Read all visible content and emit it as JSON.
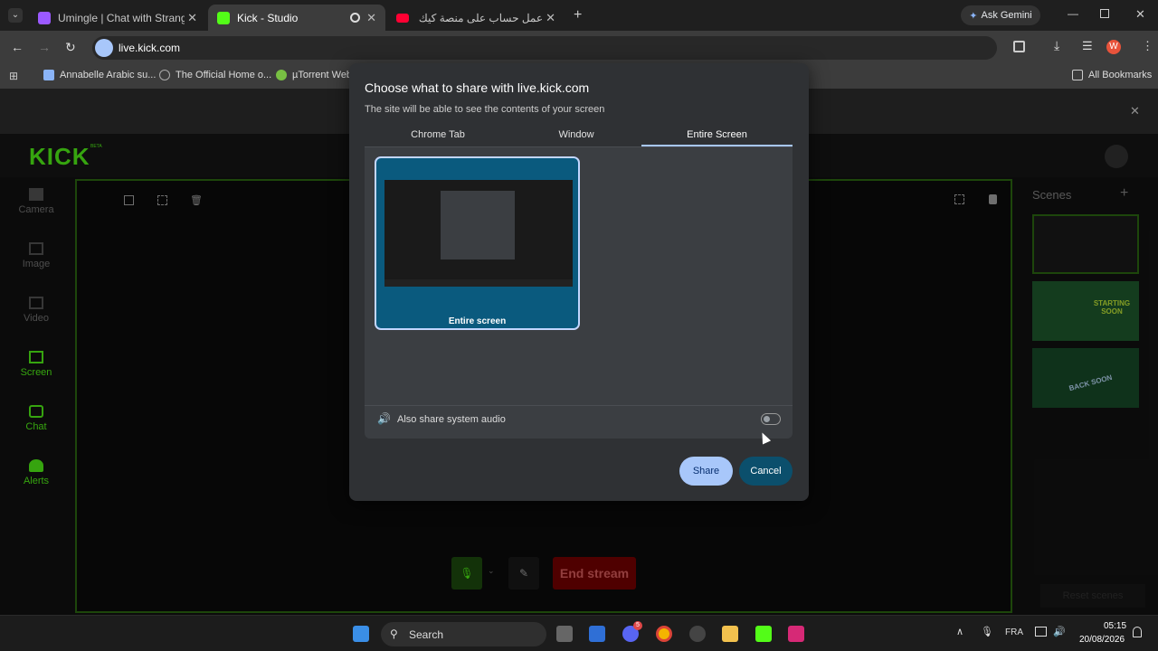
{
  "browser": {
    "tabs": [
      {
        "label": "Umingle | Chat with Strangers I",
        "favicon": "umingle-icon",
        "active": false
      },
      {
        "label": "Kick - Studio",
        "favicon": "kick-icon",
        "active": true
      },
      {
        "label": "عمل حساب على منصة كيك و طر",
        "favicon": "youtube-icon",
        "active": false
      }
    ],
    "ask_gemini": "Ask Gemini",
    "address": "live.kick.com",
    "bookmarks": [
      "Annabelle Arabic su...",
      "The Official Home o...",
      "µTorrent Web"
    ],
    "all_bookmarks": "All Bookmarks",
    "profile_initial": "W"
  },
  "kick": {
    "logo": "KICK",
    "logo_badge": "BETA",
    "sidebar": [
      {
        "label": "Camera",
        "icon": "camera-icon",
        "active": false
      },
      {
        "label": "Image",
        "icon": "image-icon",
        "active": false
      },
      {
        "label": "Video",
        "icon": "video-icon",
        "active": false
      },
      {
        "label": "Screen",
        "icon": "screen-share-icon",
        "active": true
      },
      {
        "label": "Chat",
        "icon": "chat-icon",
        "active": true
      },
      {
        "label": "Alerts",
        "icon": "alerts-icon",
        "active": true
      }
    ],
    "scenes_title": "Scenes",
    "scene_thumbs": [
      "",
      "STARTING SOON",
      "BACK SOON"
    ],
    "end_stream": "End stream",
    "reset_scenes": "Reset scenes"
  },
  "dialog": {
    "title": "Choose what to share with live.kick.com",
    "subtitle": "The site will be able to see the contents of your screen",
    "tabs": [
      "Chrome Tab",
      "Window",
      "Entire Screen"
    ],
    "selected_tab": "Entire Screen",
    "screen_label": "Entire screen",
    "audio_label": "Also share system audio",
    "audio_enabled": false,
    "share": "Share",
    "cancel": "Cancel"
  },
  "taskbar": {
    "search": "Search",
    "language": "FRA",
    "time": "05:15",
    "date": "20/08/2026",
    "discord_badge": "5"
  },
  "colors": {
    "kick_green": "#53fc18",
    "share_blue": "#a8c7fa",
    "cancel_teal": "#0b4f6c"
  }
}
